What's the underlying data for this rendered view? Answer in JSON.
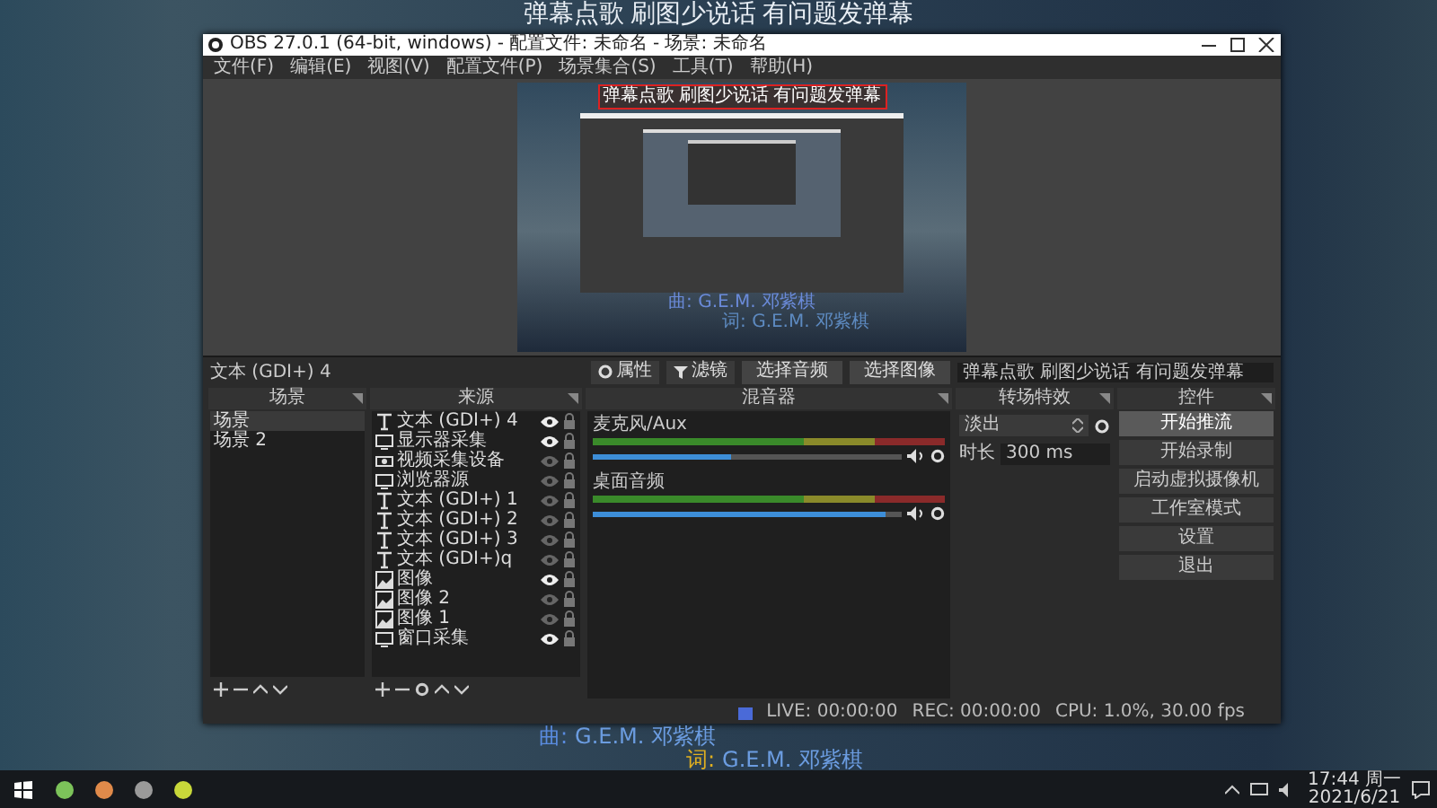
{
  "desktop": {
    "banner": "弹幕点歌 刷图少说话 有问题发弹幕",
    "lyrics": [
      {
        "label": "曲:",
        "text": "G.E.M. 邓紫棋"
      },
      {
        "label": "词:",
        "text": "G.E.M. 邓紫棋"
      }
    ]
  },
  "window": {
    "title": "OBS 27.0.1 (64-bit, windows) - 配置文件: 未命名 - 场景: 未命名",
    "menu": [
      "文件(F)",
      "编辑(E)",
      "视图(V)",
      "配置文件(P)",
      "场景集合(S)",
      "工具(T)",
      "帮助(H)"
    ]
  },
  "preview": {
    "banner": "弹幕点歌 刷图少说话 有问题发弹幕",
    "lyrics": [
      {
        "label": "曲:",
        "text": "G.E.M. 邓紫棋"
      },
      {
        "label": "词:",
        "text": "G.E.M. 邓紫棋"
      }
    ]
  },
  "toolbar": {
    "source_label": "文本 (GDI+) 4",
    "buttons": [
      "属性",
      "滤镜"
    ],
    "actions": [
      "选择音频",
      "选择图像"
    ],
    "value": "弹幕点歌 刷图少说话 有问题发弹幕"
  },
  "scenes": {
    "title": "场景",
    "items": [
      {
        "label": "场景",
        "selected": true
      },
      {
        "label": "场景 2",
        "selected": false
      }
    ]
  },
  "sources": {
    "title": "来源",
    "items": [
      {
        "kind": "text",
        "label": "文本 (GDI+) 4",
        "visible": true
      },
      {
        "kind": "display",
        "label": "显示器采集",
        "visible": true
      },
      {
        "kind": "camera",
        "label": "视频采集设备",
        "visible": false
      },
      {
        "kind": "display",
        "label": "浏览器源",
        "visible": false
      },
      {
        "kind": "text",
        "label": "文本 (GDI+) 1",
        "visible": false
      },
      {
        "kind": "text",
        "label": "文本 (GDI+) 2",
        "visible": false
      },
      {
        "kind": "text",
        "label": "文本 (GDI+) 3",
        "visible": false
      },
      {
        "kind": "text",
        "label": "文本 (GDI+)q",
        "visible": false
      },
      {
        "kind": "image",
        "label": "图像",
        "visible": true
      },
      {
        "kind": "image",
        "label": "图像 2",
        "visible": false
      },
      {
        "kind": "image",
        "label": "图像 1",
        "visible": false
      },
      {
        "kind": "display",
        "label": "窗口采集",
        "visible": true
      }
    ]
  },
  "mixer": {
    "title": "混音器",
    "channels": [
      {
        "name": "麦克风/Aux",
        "level": 0.45
      },
      {
        "name": "桌面音频",
        "level": 0.95
      }
    ]
  },
  "transitions": {
    "title": "转场特效",
    "type": "淡出",
    "duration_label": "时长",
    "duration": "300 ms"
  },
  "controls": {
    "title": "控件",
    "buttons": [
      {
        "label": "开始推流",
        "selected": true
      },
      {
        "label": "开始录制",
        "selected": false
      },
      {
        "label": "启动虚拟摄像机",
        "selected": false
      },
      {
        "label": "工作室模式",
        "selected": false
      },
      {
        "label": "设置",
        "selected": false
      },
      {
        "label": "退出",
        "selected": false
      }
    ]
  },
  "status_bar": [
    "LIVE: 00:00:00",
    "REC: 00:00:00",
    "CPU: 1.0%, 30.00 fps"
  ],
  "taskbar": {
    "apps": [
      {
        "color": "#7cc35a"
      },
      {
        "color": "#e08a4a"
      },
      {
        "color": "#9a9a9a"
      },
      {
        "color": "#c8d83a"
      }
    ],
    "time": "17:44 周一",
    "date": "2021/6/21"
  }
}
